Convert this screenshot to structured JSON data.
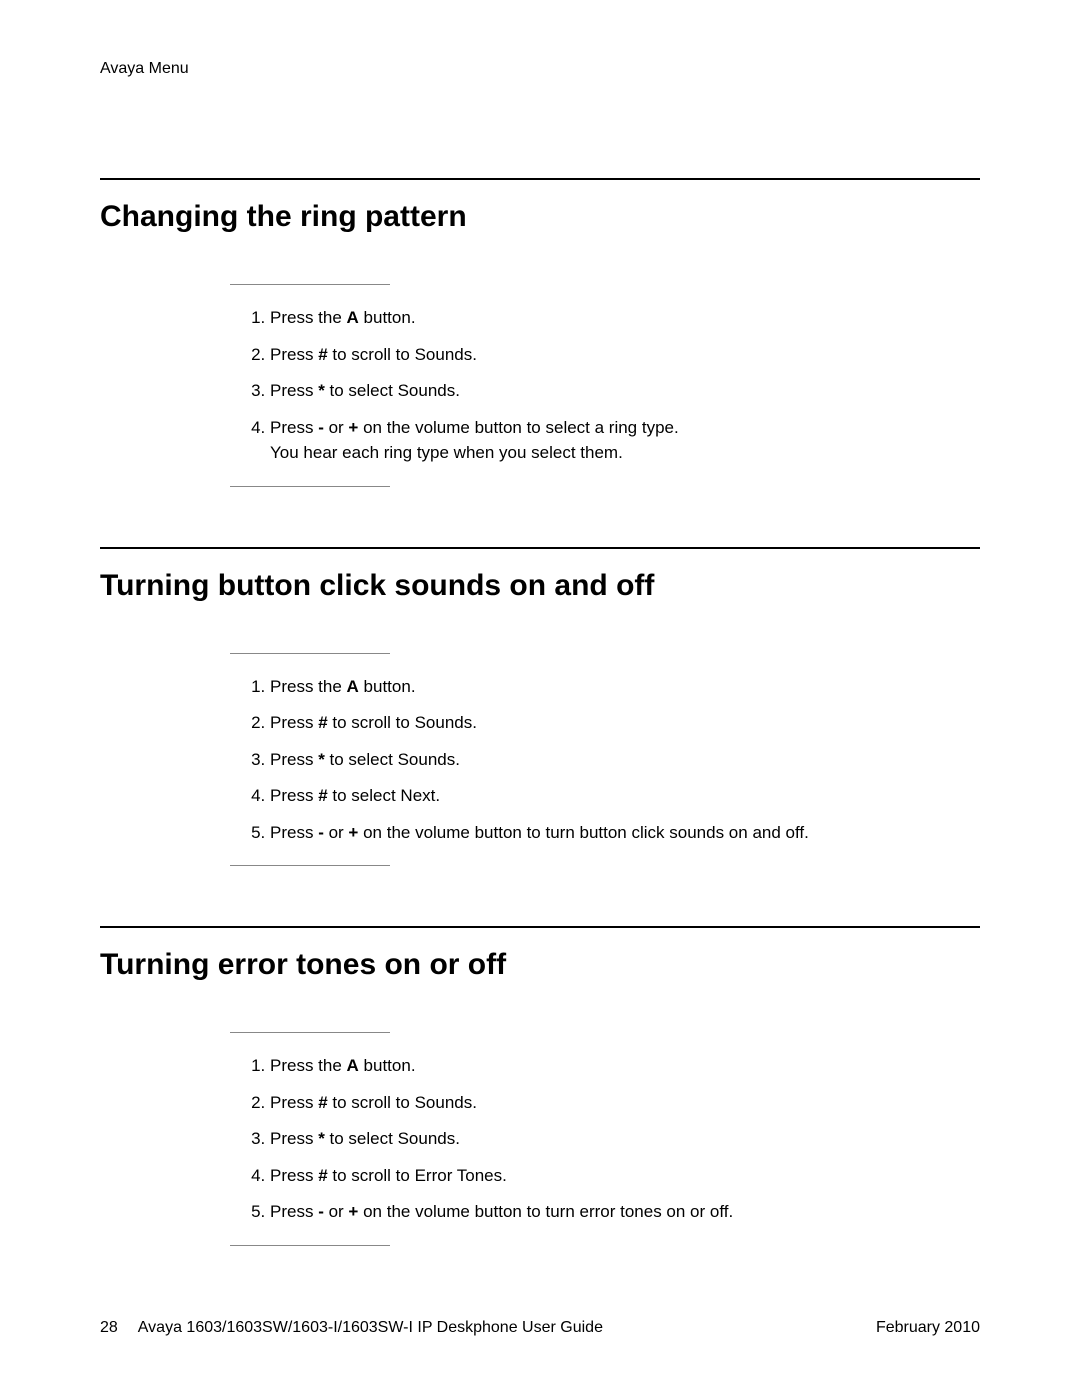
{
  "header": "Avaya Menu",
  "sections": [
    {
      "title": "Changing the ring pattern",
      "steps": [
        {
          "pre": "Press the ",
          "bold": "A",
          "post": " button."
        },
        {
          "pre": "Press ",
          "bold": "#",
          "post": " to scroll to Sounds."
        },
        {
          "pre": "Press ",
          "bold": "*",
          "post": " to select Sounds."
        },
        {
          "pre": "Press ",
          "bold": "-",
          "mid": " or ",
          "bold2": "+",
          "post": " on the volume button to select a ring type.",
          "cont": "You hear each ring type when you select them."
        }
      ]
    },
    {
      "title": "Turning button click sounds on and off",
      "steps": [
        {
          "pre": "Press the ",
          "bold": "A",
          "post": " button."
        },
        {
          "pre": "Press ",
          "bold": "#",
          "post": " to scroll to Sounds."
        },
        {
          "pre": "Press ",
          "bold": "*",
          "post": " to select Sounds."
        },
        {
          "pre": "Press ",
          "bold": "#",
          "post": " to select Next."
        },
        {
          "pre": "Press ",
          "bold": "-",
          "mid": " or ",
          "bold2": "+",
          "post": " on the volume button to turn button click sounds on and off."
        }
      ]
    },
    {
      "title": "Turning error tones on or off",
      "steps": [
        {
          "pre": "Press the ",
          "bold": "A",
          "post": " button."
        },
        {
          "pre": "Press ",
          "bold": "#",
          "post": " to scroll to Sounds."
        },
        {
          "pre": "Press ",
          "bold": "*",
          "post": " to select Sounds."
        },
        {
          "pre": "Press ",
          "bold": "#",
          "post": " to scroll to Error Tones."
        },
        {
          "pre": "Press ",
          "bold": "-",
          "mid": " or ",
          "bold2": "+",
          "post": " on the volume button to turn error tones on or off."
        }
      ]
    }
  ],
  "footer": {
    "page": "28",
    "title": "Avaya 1603/1603SW/1603-I/1603SW-I IP Deskphone User Guide",
    "date": "February 2010"
  }
}
